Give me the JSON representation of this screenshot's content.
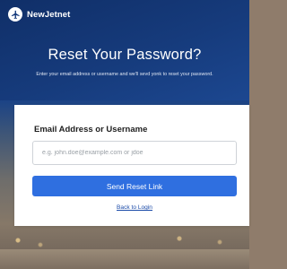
{
  "brand": {
    "name": "NewJetnet",
    "logo_icon": "plane-icon"
  },
  "header": {
    "title": "Reset Your Password?",
    "subtitle": "Enter your email address or username and we'll sevd yonk to reset your password."
  },
  "form": {
    "field_label": "Email Address or Username",
    "input_value": "",
    "input_placeholder": "e.g. john.doe@example.com or jdoe",
    "submit_label": "Send Reset Link",
    "back_link_label": "Back to Login"
  },
  "colors": {
    "header_background": "#163b7c",
    "primary_button": "#2f6fe0",
    "link": "#1a4aa8",
    "card_background": "#ffffff"
  }
}
